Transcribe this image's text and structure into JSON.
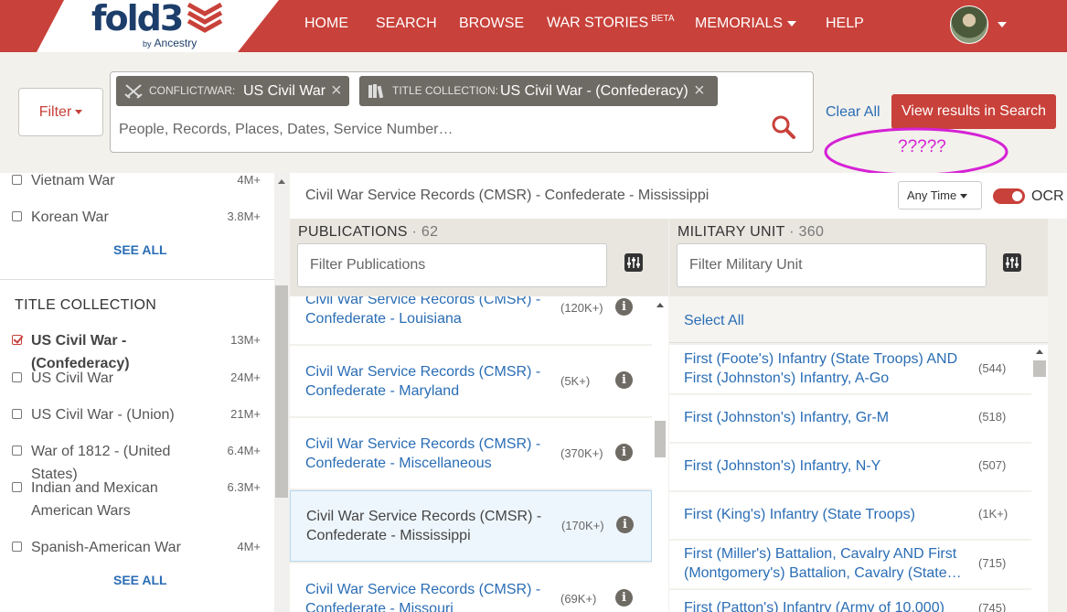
{
  "brand": {
    "name": "fold3",
    "by": "by",
    "partner": "Ancestry",
    "accent": "#c8413a",
    "link_color": "#2a6db5"
  },
  "nav": {
    "home": "HOME",
    "search": "SEARCH",
    "browse": "BROWSE",
    "war_stories": "WAR STORIES",
    "war_stories_badge": "BETA",
    "memorials": "MEMORIALS",
    "help": "HELP"
  },
  "search": {
    "filter_label": "Filter",
    "chips": [
      {
        "icon": "crossed-swords-icon",
        "key": "CONFLICT/WAR:",
        "value": "US Civil War"
      },
      {
        "icon": "books-icon",
        "key": "TITLE COLLECTION:",
        "value": "US Civil War - (Confederacy)"
      }
    ],
    "placeholder": "People, Records, Places, Dates, Service Number…",
    "clear_all": "Clear All",
    "view_results": "View results in Search",
    "annotation": "?????"
  },
  "sidebar": {
    "conflicts": [
      {
        "label": "Vietnam War",
        "count": "4M+",
        "checked": false
      },
      {
        "label": "Korean War",
        "count": "3.8M+",
        "checked": false
      }
    ],
    "see_all_1": "SEE ALL",
    "title_collection_heading": "TITLE COLLECTION",
    "collections": [
      {
        "label": "US Civil War - (Confederacy)",
        "count": "13M+",
        "checked": true
      },
      {
        "label": "US Civil War",
        "count": "24M+",
        "checked": false
      },
      {
        "label": "US Civil War - (Union)",
        "count": "21M+",
        "checked": false
      },
      {
        "label": "War of 1812 - (United States)",
        "count": "6.4M+",
        "checked": false
      },
      {
        "label": "Indian and Mexican American Wars",
        "count": "6.3M+",
        "checked": false
      },
      {
        "label": "Spanish-American War",
        "count": "4M+",
        "checked": false
      }
    ],
    "see_all_2": "SEE ALL"
  },
  "main": {
    "title": "Civil War Service Records (CMSR) - Confederate - Mississippi",
    "time_filter": "Any Time",
    "ocr_label": "OCR",
    "ocr_enabled": true
  },
  "publications": {
    "heading": "PUBLICATIONS",
    "count": "62",
    "filter_placeholder": "Filter Publications",
    "items": [
      {
        "title": "Civil War Service Records (CMSR) - Confederate - Louisiana",
        "count": "(120K+)"
      },
      {
        "title": "Civil War Service Records (CMSR) - Confederate - Maryland",
        "count": "(5K+)"
      },
      {
        "title": "Civil War Service Records (CMSR) - Confederate - Miscellaneous",
        "count": "(370K+)"
      },
      {
        "title": "Civil War Service Records (CMSR) - Confederate - Mississippi",
        "count": "(170K+)",
        "selected": true
      },
      {
        "title": "Civil War Service Records (CMSR) - Confederate - Missouri",
        "count": "(69K+)"
      }
    ]
  },
  "military_unit": {
    "heading": "MILITARY UNIT",
    "count": "360",
    "filter_placeholder": "Filter Military Unit",
    "select_all": "Select All",
    "items": [
      {
        "title": "First (Foote's) Infantry (State Troops) AND First (Johnston's) Infantry, A-Go",
        "count": "(544)"
      },
      {
        "title": "First (Johnston's) Infantry, Gr-M",
        "count": "(518)"
      },
      {
        "title": "First (Johnston's) Infantry, N-Y",
        "count": "(507)"
      },
      {
        "title": "First (King's) Infantry (State Troops)",
        "count": "(1K+)"
      },
      {
        "title": "First (Miller's) Battalion, Cavalry AND First (Montgomery's) Battalion, Cavalry (State…",
        "count": "(715)"
      },
      {
        "title": "First (Patton's) Infantry (Army of 10,000)",
        "count": "(745)"
      }
    ]
  }
}
